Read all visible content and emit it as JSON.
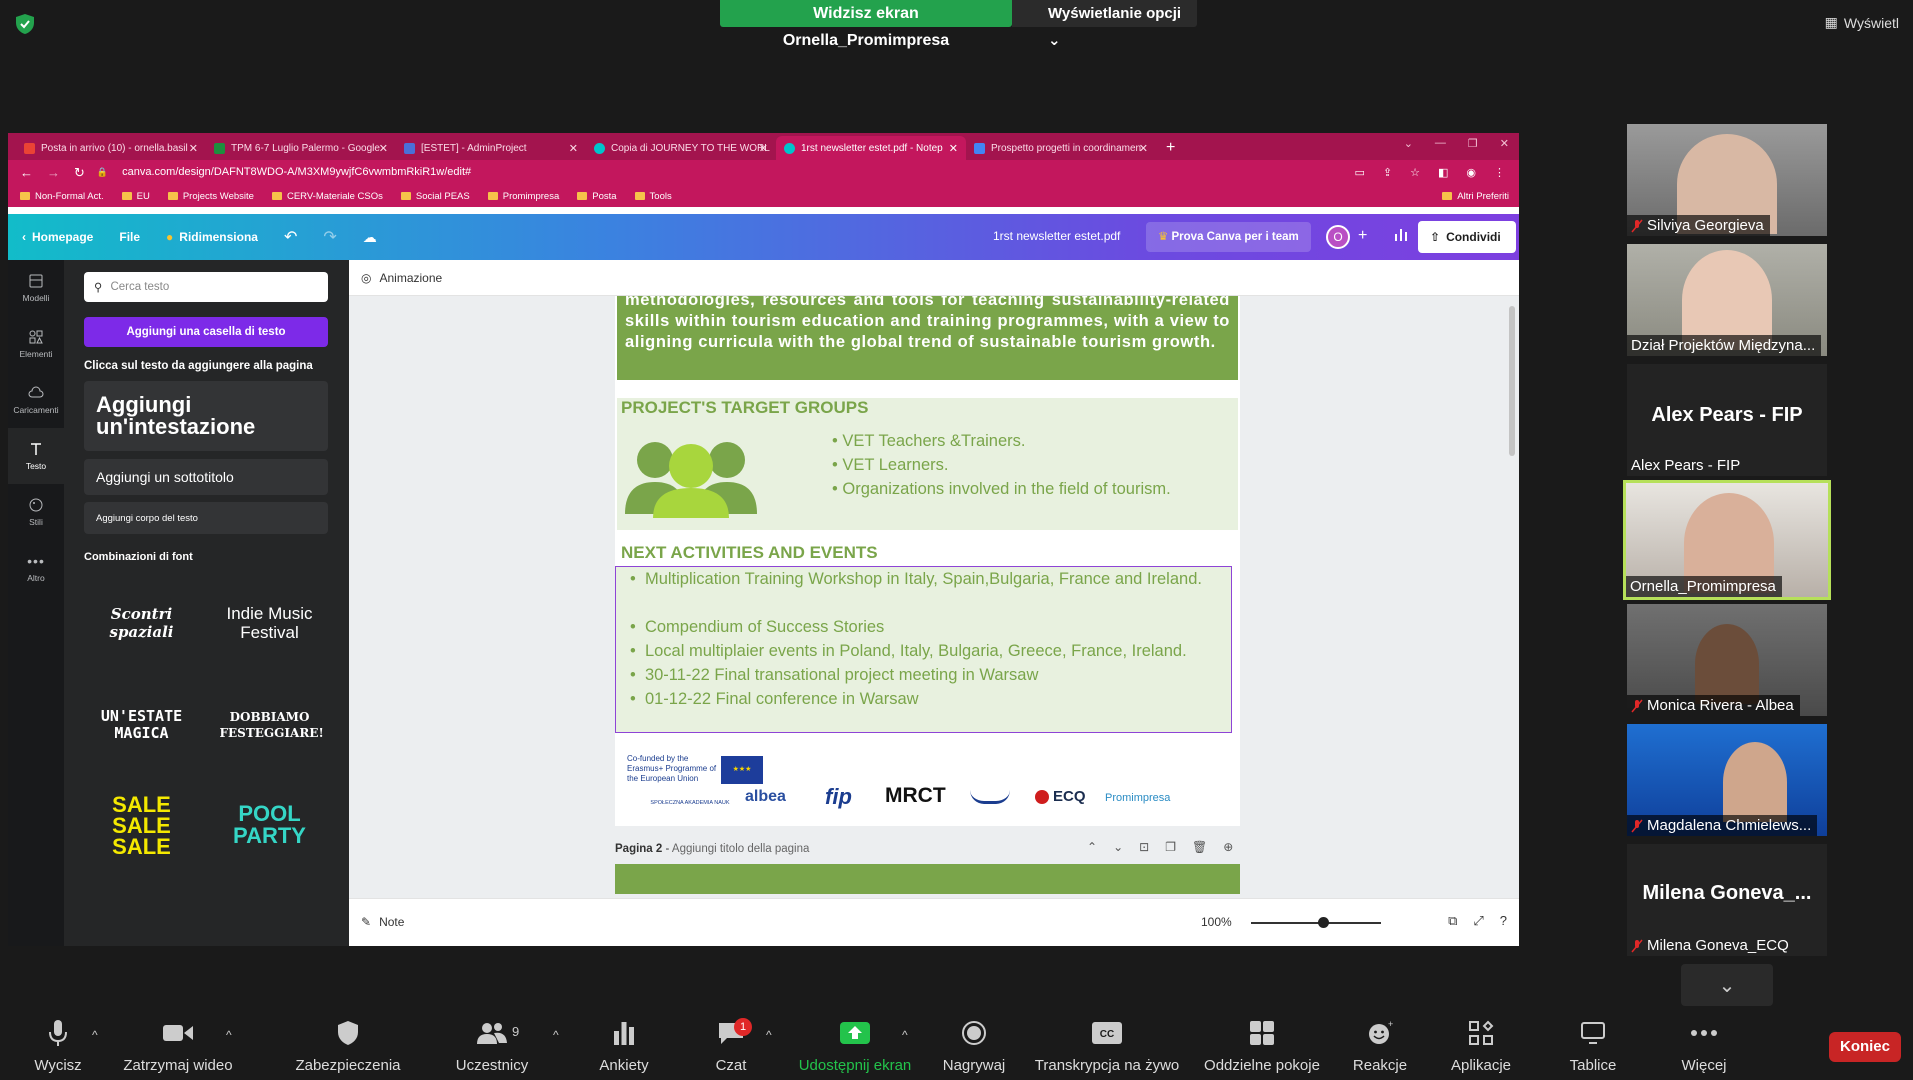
{
  "zoom": {
    "share_banner": "Widzisz ekran Ornella_Promimpresa",
    "view_options": "Wyświetlanie opcji",
    "view_top_right": "Wyświetl",
    "end_button": "Koniec",
    "participants_count": "9",
    "chat_badge": "1",
    "toolbar": [
      {
        "label": "Wycisz",
        "icon": "microphone-icon"
      },
      {
        "label": "Zatrzymaj wideo",
        "icon": "video-camera-icon"
      },
      {
        "label": "Zabezpieczenia",
        "icon": "shield-icon"
      },
      {
        "label": "Uczestnicy",
        "icon": "participants-icon"
      },
      {
        "label": "Ankiety",
        "icon": "polls-icon"
      },
      {
        "label": "Czat",
        "icon": "chat-icon"
      },
      {
        "label": "Udostępnij ekran",
        "icon": "share-screen-icon"
      },
      {
        "label": "Nagrywaj",
        "icon": "record-icon"
      },
      {
        "label": "Transkrypcja na żywo",
        "icon": "cc-icon"
      },
      {
        "label": "Oddzielne pokoje",
        "icon": "breakout-rooms-icon"
      },
      {
        "label": "Reakcje",
        "icon": "reactions-icon"
      },
      {
        "label": "Aplikacje",
        "icon": "apps-icon"
      },
      {
        "label": "Tablice",
        "icon": "whiteboard-icon"
      },
      {
        "label": "Więcej",
        "icon": "more-icon"
      }
    ],
    "participants": [
      {
        "name": "Silviya Georgieva",
        "muted": true,
        "video": true
      },
      {
        "name": "Dział Projektów Międzyna...",
        "muted": false,
        "video": true
      },
      {
        "name": "Alex Pears - FIP",
        "display": "Alex Pears - FIP",
        "muted": false,
        "video": false
      },
      {
        "name": "Ornella_Promimpresa",
        "muted": false,
        "video": true
      },
      {
        "name": "Monica Rivera - Albea",
        "muted": true,
        "video": true
      },
      {
        "name": "Magdalena Chmielews...",
        "muted": true,
        "video": true
      },
      {
        "name": "Milena Goneva_ECQ",
        "display": "Milena Goneva_...",
        "muted": true,
        "video": false
      }
    ]
  },
  "browser": {
    "tabs": [
      {
        "title": "Posta in arrivo (10) - ornella.basil",
        "color": "#ea4335"
      },
      {
        "title": "TPM 6-7 Luglio Palermo - Google",
        "color": "#1e8e3e"
      },
      {
        "title": "[ESTET] - AdminProject",
        "color": "#4a6fd8"
      },
      {
        "title": "Copia di JOURNEY TO THE WORL",
        "color": "#00c4cc"
      },
      {
        "title": "1rst newsletter estet.pdf - Notep",
        "color": "#00c4cc"
      },
      {
        "title": "Prospetto progetti in coordinamen",
        "color": "#4285f4"
      }
    ],
    "new_tab": "+",
    "url": "canva.com/design/DAFNT8WDO-A/M3XM9ywjfC6vwmbmRkiR1w/edit#",
    "bookmarks": [
      "Non-Formal Act.",
      "EU",
      "Projects Website",
      "CERV-Materiale CSOs",
      "Social PEAS",
      "Promimpresa",
      "Posta",
      "Tools"
    ],
    "bookmarks_right": "Altri Preferiti"
  },
  "canva": {
    "homepage": "Homepage",
    "file": "File",
    "resize": "Ridimensiona",
    "doc_title": "1rst newsletter estet.pdf",
    "try_team": "Prova Canva per i team",
    "avatar_letter": "O",
    "share": "Condividi",
    "rail": [
      {
        "label": "Modelli",
        "icon": "templates-icon"
      },
      {
        "label": "Elementi",
        "icon": "elements-icon"
      },
      {
        "label": "Caricamenti",
        "icon": "uploads-icon"
      },
      {
        "label": "Testo",
        "icon": "text-icon"
      },
      {
        "label": "Stili",
        "icon": "styles-icon"
      },
      {
        "label": "Altro",
        "icon": "more-icon"
      }
    ],
    "panel": {
      "search_placeholder": "Cerca testo",
      "add_textbox": "Aggiungi una casella di testo",
      "click_hint": "Clicca sul testo da aggiungere alla pagina",
      "add_heading": "Aggiungi un'intestazione",
      "add_subtitle": "Aggiungi un sottotitolo",
      "add_body": "Aggiungi corpo del testo",
      "font_combos_title": "Combinazioni di font",
      "combos": [
        "Scontri spaziali",
        "Indie Music Festival",
        "UN'ESTATE MAGICA",
        "DOBBIAMO FESTEGGIARE!",
        "SALE SALE SALE",
        "POOL PARTY"
      ]
    },
    "animation": "Animazione",
    "page": {
      "intro": "methodologies, resources and tools for teaching sustainability-related skills within tourism education and training programmes, with a view to aligning curricula with the global trend of sustainable tourism growth.",
      "target_title": "PROJECT'S TARGET GROUPS",
      "target_groups": [
        "VET Teachers &Trainers.",
        "VET Learners.",
        "Organizations involved in the field of tourism."
      ],
      "activities_title": "NEXT ACTIVITIES AND EVENTS",
      "activities": [
        "Multiplication Training Workshop in Italy, Spain,Bulgaria, France and Ireland.",
        "Compendium of Success Stories",
        "Local multiplaier events in Poland, Italy, Bulgaria, Greece, France, Ireland.",
        "30-11-22 Final transational project meeting in Warsaw",
        "01-12-22 Final conference in Warsaw"
      ],
      "erasmus": "Co-funded by the Erasmus+ Programme of the European Union",
      "partners": [
        "SPOŁECZNA AKADEMIA NAUK",
        "albea",
        "fip",
        "MRCT",
        "ECQ",
        "Promimpresa"
      ]
    },
    "page2_label": "Pagina 2",
    "page2_placeholder": "Aggiungi titolo della pagina",
    "notes": "Note",
    "zoom_level": "100%",
    "zoom_fraction": 0.55
  }
}
